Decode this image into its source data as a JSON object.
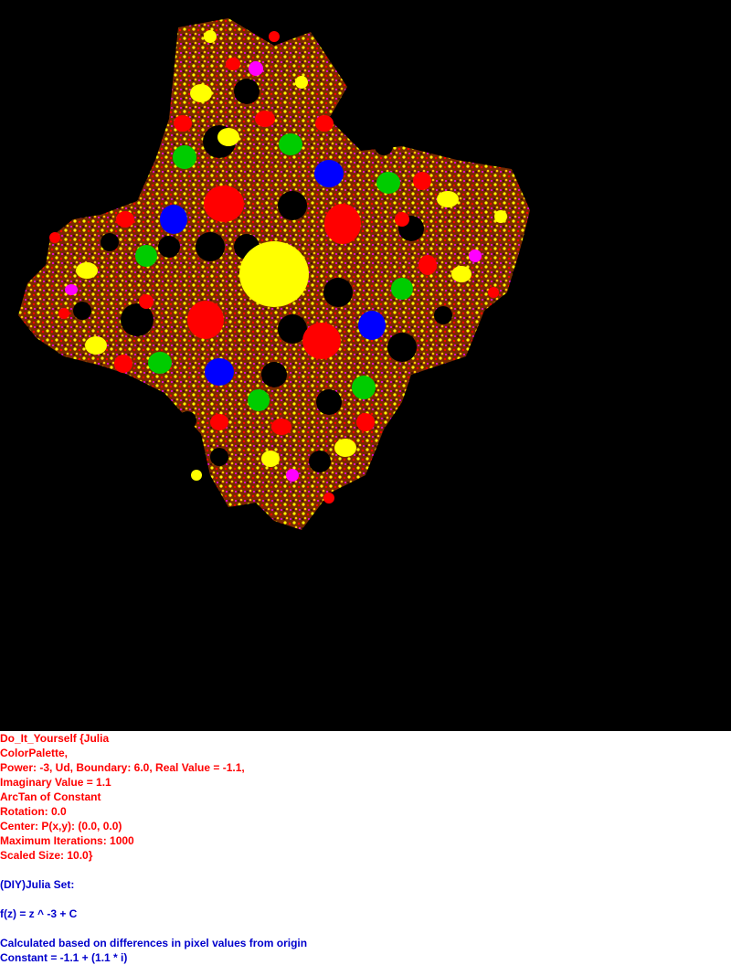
{
  "image": {
    "background_color": "#000000",
    "palette": [
      "#ffff00",
      "#ff0000",
      "#00cc00",
      "#0000ff",
      "#ff00ff"
    ]
  },
  "parameters": {
    "line1": "Do_It_Yourself {Julia",
    "line2": "ColorPalette,",
    "line3": "Power: -3, Ud, Boundary: 6.0, Real Value = -1.1,",
    "line4": "Imaginary Value = 1.1",
    "line5": "ArcTan of Constant",
    "line6": "Rotation: 0.0",
    "line7": "Center: P(x,y): (0.0, 0.0)",
    "line8": "Maximum Iterations: 1000",
    "line9": "Scaled Size: 10.0}"
  },
  "description": {
    "title": "(DIY)Julia Set:",
    "formula": "f(z) = z ^ -3 + C",
    "method": "Calculated based on differences in pixel values from origin",
    "constant": "Constant = -1.1 + (1.1 * i)"
  },
  "colors": {
    "parameters_text": "#ff0000",
    "description_text": "#0000cc"
  }
}
